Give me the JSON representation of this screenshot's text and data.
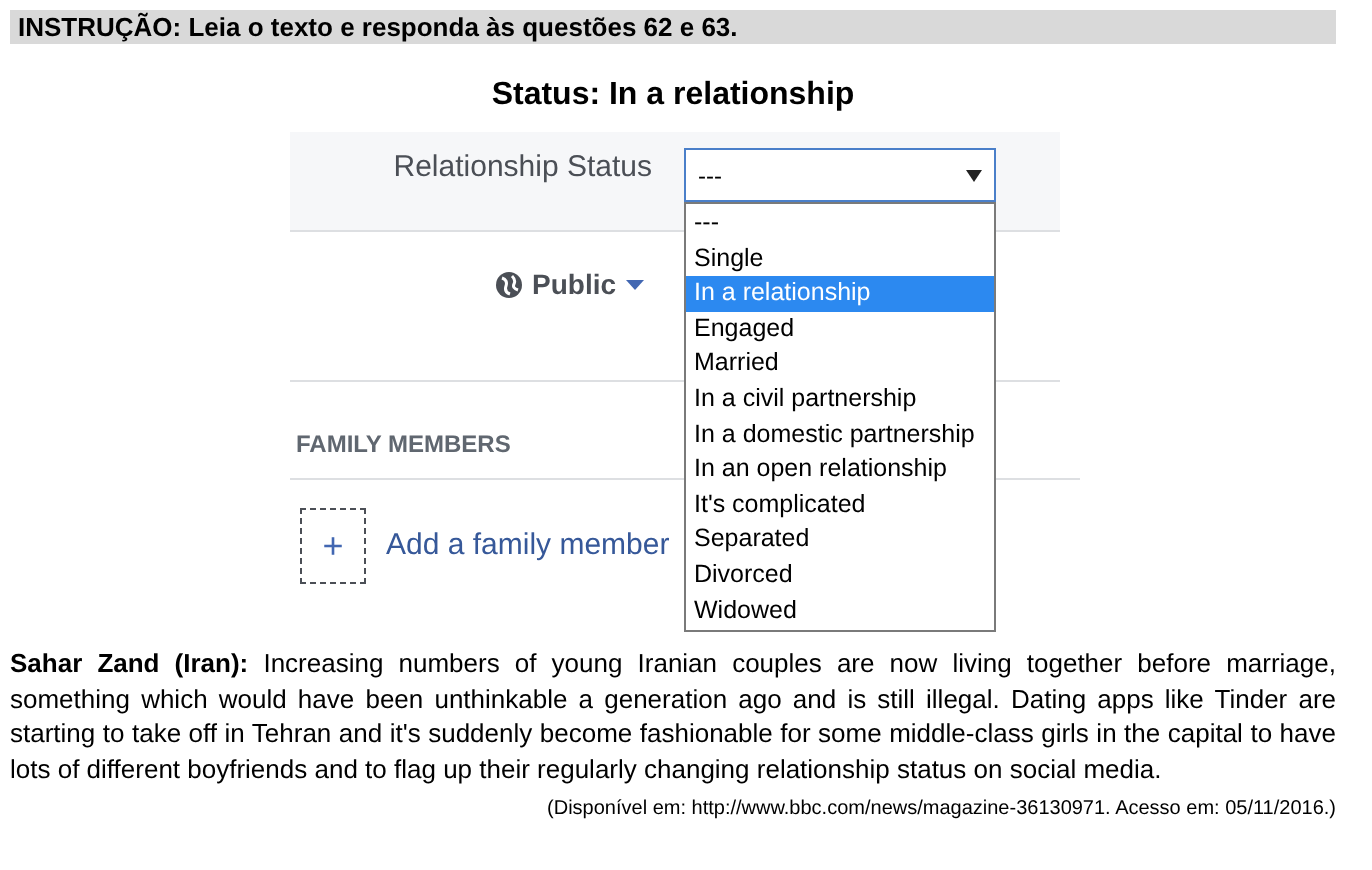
{
  "instruction": "INSTRUÇÃO: Leia o texto e responda às questões 62 e 63.",
  "title": "Status: In a relationship",
  "screenshot": {
    "status_label": "Relationship Status",
    "select": {
      "value": "---",
      "expanded": true
    },
    "options": [
      {
        "label": "---",
        "selected": false
      },
      {
        "label": "Single",
        "selected": false
      },
      {
        "label": "In a relationship",
        "selected": true
      },
      {
        "label": "Engaged",
        "selected": false
      },
      {
        "label": "Married",
        "selected": false
      },
      {
        "label": "In a civil partnership",
        "selected": false
      },
      {
        "label": "In a domestic partnership",
        "selected": false
      },
      {
        "label": "In an open relationship",
        "selected": false
      },
      {
        "label": "It's complicated",
        "selected": false
      },
      {
        "label": "Separated",
        "selected": false
      },
      {
        "label": "Divorced",
        "selected": false
      },
      {
        "label": "Widowed",
        "selected": false
      }
    ],
    "privacy": "Public",
    "section_heading": "FAMILY MEMBERS",
    "add_icon": "+",
    "add_link": "Add a family member"
  },
  "passage": "**Sahar Zand (Iran):** Increasing numbers of young Iranian couples are now living together before marriage, something which would have been unthinkable a generation ago and is still illegal. Dating apps like Tinder are starting to take off in Tehran and it's suddenly become fashionable for some middle-class girls in the capital to have lots of different boyfriends and to flag up their regularly changing relationship status on social media.",
  "citation": "(Disponível em: http://www.bbc.com/news/magazine-36130971. Acesso em: 05/11/2016.)"
}
